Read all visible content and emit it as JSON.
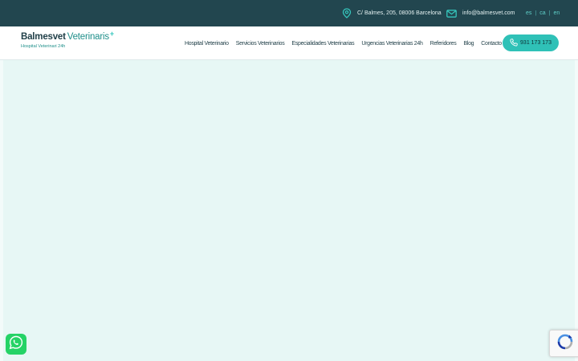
{
  "topbar": {
    "address": "C/ Balmes, 205, 08006 Barcelona",
    "email": "info@balmesvet.com",
    "languages": [
      "es",
      "ca",
      "en"
    ]
  },
  "logo": {
    "name_bold": "Balmesvet",
    "name_light": "Veterinaris",
    "plus": "+",
    "tagline": "Hospital Veterinari 24h"
  },
  "nav": {
    "items": [
      "Hospital Veterinario",
      "Servicios Veterinarios",
      "Especialidades Veterinarias",
      "Urgencias Veterinarias 24h",
      "Referidores",
      "Blog",
      "Contacto"
    ]
  },
  "call": {
    "phone": "931 173 173"
  },
  "colors": {
    "topbar_bg": "#22464f",
    "accent": "#2fc1b7",
    "hero_bg": "#e7f7f5",
    "whatsapp": "#25d366"
  },
  "icons": {
    "address": "map-pin-icon",
    "email": "mail-icon",
    "phone": "phone-icon",
    "whatsapp": "whatsapp-icon",
    "recaptcha": "recaptcha-icon"
  }
}
